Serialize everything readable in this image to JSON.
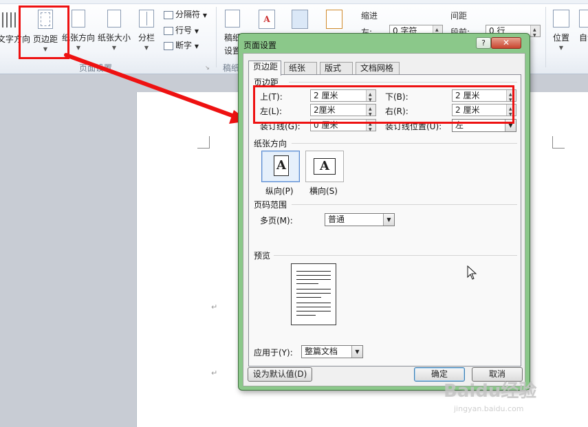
{
  "ribbon": {
    "buttons": {
      "text_direction": "文字方向",
      "margins": "页边距",
      "orientation": "纸张方向",
      "size": "纸张大小",
      "columns": "分栏",
      "draft_settings_1": "稿纸",
      "draft_settings_2": "设置",
      "position": "位置",
      "wrap_text": "自动"
    },
    "small_items": {
      "breaks": "分隔符",
      "line_numbers": "行号",
      "hyphenation": "断字"
    },
    "indent_label": "缩进",
    "indent_left_label": "左:",
    "indent_left_value": "0 字符",
    "spacing_label": "间距",
    "spacing_before_label": "段前:",
    "spacing_before_value": "0 行",
    "group_page_setup": "页面设置",
    "group_draft": "稿纸"
  },
  "dialog": {
    "title": "页面设置",
    "help": "?",
    "close": "✕",
    "tabs": [
      "页边距",
      "纸张",
      "版式",
      "文档网格"
    ],
    "margins_section": "页边距",
    "top_label": "上(T):",
    "top_value": "2 厘米",
    "bottom_label": "下(B):",
    "bottom_value": "2 厘米",
    "left_label": "左(L):",
    "left_value": "2厘米",
    "right_label": "右(R):",
    "right_value": "2 厘米",
    "gutter_label": "装订线(G):",
    "gutter_value": "0 厘米",
    "gutter_pos_label": "装订线位置(U):",
    "gutter_pos_value": "左",
    "orientation_section": "纸张方向",
    "portrait": "纵向(P)",
    "landscape": "横向(S)",
    "pages_section": "页码范围",
    "multiple_pages_label": "多页(M):",
    "multiple_pages_value": "普通",
    "preview_section": "预览",
    "apply_to_label": "应用于(Y):",
    "apply_to_value": "整篇文档",
    "set_default_button": "设为默认值(D)",
    "ok_button": "确定",
    "cancel_button": "取消"
  },
  "watermark": {
    "brand": "Baidu经验",
    "url": "jingyan.baidu.com"
  },
  "colors": {
    "highlight_red": "#ee1111",
    "dialog_frame_green": "#8bc88a"
  }
}
